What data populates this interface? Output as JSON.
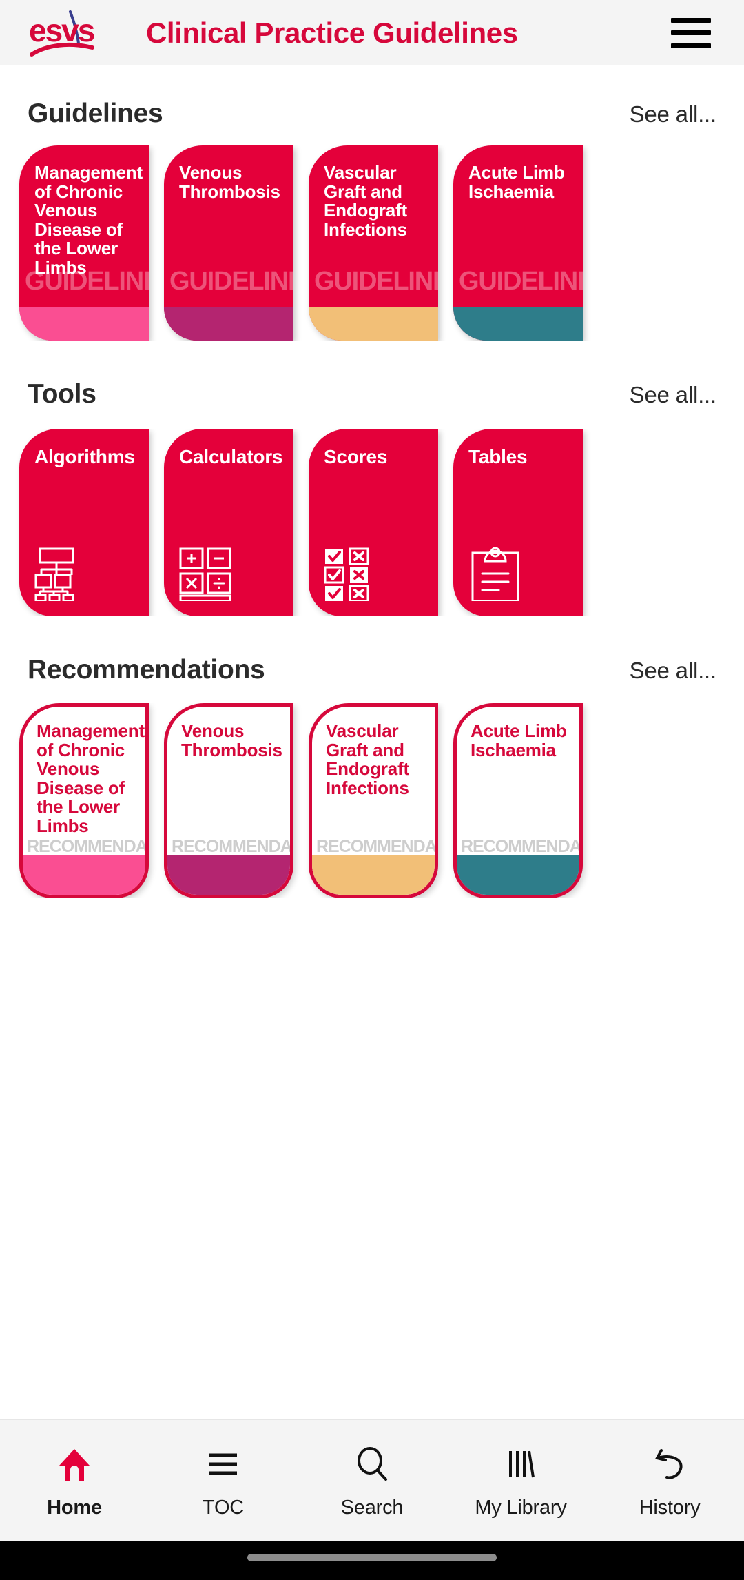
{
  "header": {
    "logo_alt": "esvs",
    "title": "Clinical Practice Guidelines",
    "menu_icon": "hamburger-menu-icon"
  },
  "colors": {
    "brand_red": "#E4003A",
    "brand_red_dark": "#D6083B",
    "header_bg": "#f4f4f4",
    "accent_pink": "#FA4E92",
    "accent_magenta": "#B42570",
    "accent_tan": "#F2BF77",
    "accent_teal": "#2E7D8A"
  },
  "sections": [
    {
      "title": "Guidelines",
      "see_all": "See all...",
      "watermark": "GUIDELINE",
      "cards": [
        {
          "title": "Management of Chronic Venous Disease of the Lower Limbs",
          "accent": "#FA4E92"
        },
        {
          "title": "Venous Thrombosis",
          "accent": "#B42570"
        },
        {
          "title": "Vascular Graft and Endograft Infections",
          "accent": "#F2BF77"
        },
        {
          "title": "Acute Limb Ischaemia",
          "accent": "#2E7D8A"
        }
      ]
    },
    {
      "title": "Tools",
      "see_all": "See all...",
      "cards": [
        {
          "title": "Algorithms",
          "icon": "flowchart-icon"
        },
        {
          "title": "Calculators",
          "icon": "calculator-icon"
        },
        {
          "title": "Scores",
          "icon": "checklist-grid-icon"
        },
        {
          "title": "Tables",
          "icon": "clipboard-icon"
        }
      ]
    },
    {
      "title": "Recommendations",
      "see_all": "See all...",
      "watermark": "RECOMMENDATIONS",
      "cards": [
        {
          "title": "Management of Chronic Venous Disease of the Lower Limbs",
          "accent": "#FA4E92"
        },
        {
          "title": "Venous Thrombosis",
          "accent": "#B42570"
        },
        {
          "title": "Vascular Graft and Endograft Infections",
          "accent": "#F2BF77"
        },
        {
          "title": "Acute Limb Ischaemia",
          "accent": "#2E7D8A"
        }
      ]
    }
  ],
  "bottom_nav": {
    "items": [
      {
        "label": "Home",
        "icon": "home-icon",
        "active": true
      },
      {
        "label": "TOC",
        "icon": "list-icon",
        "active": false
      },
      {
        "label": "Search",
        "icon": "search-icon",
        "active": false
      },
      {
        "label": "My Library",
        "icon": "library-books-icon",
        "active": false
      },
      {
        "label": "History",
        "icon": "undo-arrow-icon",
        "active": false
      }
    ]
  }
}
